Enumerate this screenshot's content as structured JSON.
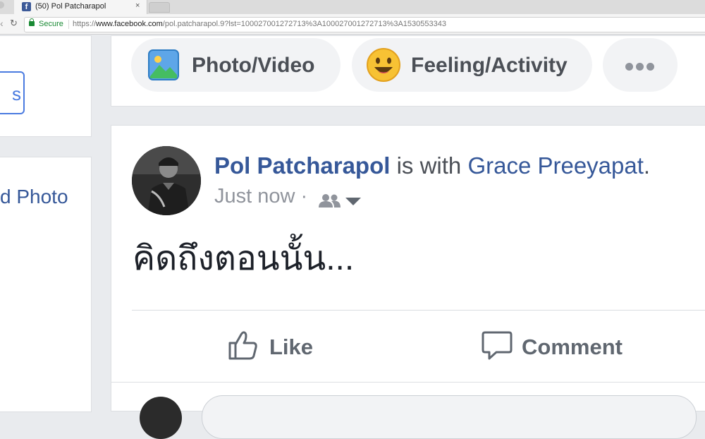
{
  "browser": {
    "tab_title": "(50) Pol Patcharapol",
    "tab_favicon": "f",
    "close_glyph": "×",
    "secure_label": "Secure",
    "url_scheme": "https://",
    "url_host": "www.facebook.com",
    "url_path": "/pol.patcharapol.9?lst=100027001272713%3A100027001272713%3A1530553343"
  },
  "left": {
    "button_text": "s",
    "link_text": "d Photo"
  },
  "composer": {
    "photo_label": "Photo/Video",
    "feeling_label": "Feeling/Activity"
  },
  "post": {
    "author": "Pol Patcharapol",
    "with_text": " is with ",
    "with_name": "Grace Preeyapat",
    "with_period": ".",
    "timestamp": "Just now",
    "dot": " · ",
    "text": "คิดถึงตอนนั้น...",
    "like_label": "Like",
    "comment_label": "Comment"
  },
  "colors": {
    "brand": "#3b5998",
    "link": "#365899",
    "secure": "#1a8a34",
    "muted": "#90949c"
  },
  "icons": [
    "facebook-favicon-icon",
    "lock-icon",
    "photo-icon",
    "smiley-icon",
    "more-icon",
    "friends-audience-icon",
    "caret-down-icon",
    "like-thumb-icon",
    "comment-bubble-icon"
  ]
}
